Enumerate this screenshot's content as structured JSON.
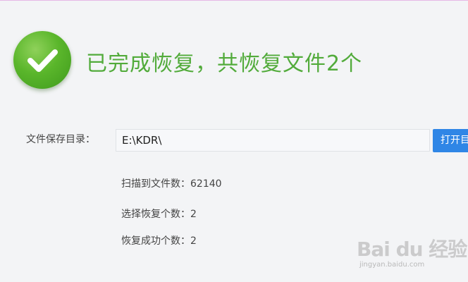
{
  "header": {
    "title": "已完成恢复，共恢复文件2个"
  },
  "save_directory": {
    "label": "文件保存目录：",
    "value": "E:\\KDR\\",
    "open_button_label": "打开目"
  },
  "stats": {
    "scanned_label": "扫描到文件数：",
    "scanned_value": "62140",
    "selected_label": "选择恢复个数：",
    "selected_value": "2",
    "success_label": "恢复成功个数：",
    "success_value": "2"
  },
  "watermark": {
    "logo": "Bai du 经验",
    "url": "jingyan.baidu.com"
  },
  "colors": {
    "success_green": "#52ab3b",
    "button_blue": "#2f86e6",
    "background": "#f3f4f6"
  },
  "icons": {
    "status": "checkmark-circle-icon"
  }
}
